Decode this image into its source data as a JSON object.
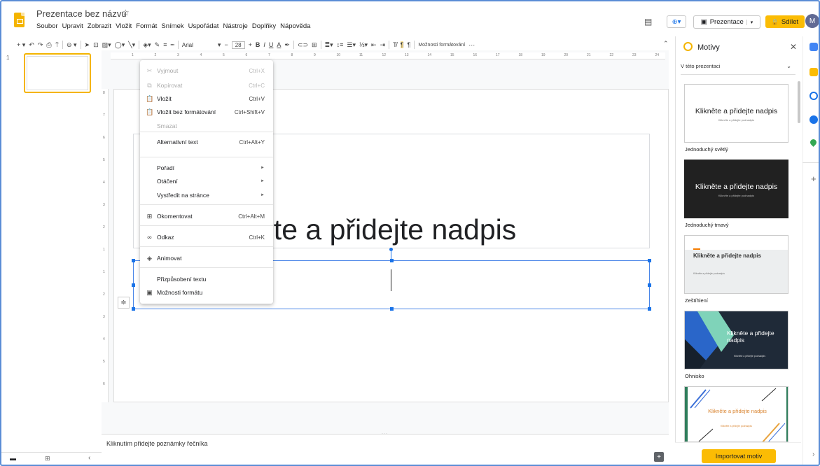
{
  "header": {
    "title": "Prezentace bez názvu",
    "star_icon": "☆",
    "menu": [
      "Soubor",
      "Upravit",
      "Zobrazit",
      "Vložit",
      "Formát",
      "Snímek",
      "Uspořádat",
      "Nástroje",
      "Doplňky",
      "Nápověda"
    ],
    "present_label": "Prezentace",
    "share_label": "Sdílet",
    "avatar_letter": "M"
  },
  "toolbar": {
    "font": "Arial",
    "font_size": "28",
    "format_options": "Možnosti formátování"
  },
  "filmstrip": {
    "slide_number": "1"
  },
  "ruler": {
    "top": [
      "1",
      "2",
      "3",
      "4",
      "5",
      "6",
      "7",
      "8",
      "9",
      "10",
      "11",
      "12",
      "13",
      "14",
      "15",
      "16",
      "17",
      "18",
      "19",
      "20",
      "21",
      "22",
      "23",
      "24"
    ],
    "left": [
      "8",
      "7",
      "6",
      "5",
      "4",
      "3",
      "2",
      "1",
      "1",
      "2",
      "3",
      "4",
      "5",
      "6"
    ]
  },
  "slide": {
    "title_placeholder": "Klikněte a přidejte nadpis",
    "visible_title_part": "ete a přidejte nadpis"
  },
  "notes": {
    "placeholder": "Kliknutím přidejte poznámky řečníka"
  },
  "context_menu": [
    {
      "label": "Vyjmout",
      "shortcut": "Ctrl+X",
      "icon": "✂",
      "disabled": true
    },
    {
      "label": "Kopírovat",
      "shortcut": "Ctrl+C",
      "icon": "⧉",
      "disabled": true
    },
    {
      "label": "Vložit",
      "shortcut": "Ctrl+V",
      "icon": "📋",
      "disabled": false
    },
    {
      "label": "Vložit bez formátování",
      "shortcut": "Ctrl+Shift+V",
      "icon": "📋",
      "disabled": false
    },
    {
      "label": "Smazat",
      "shortcut": "",
      "icon": "",
      "disabled": true
    },
    {
      "label": "Alternativní text",
      "shortcut": "Ctrl+Alt+Y",
      "icon": "",
      "disabled": false
    },
    {
      "label": "Pořadí",
      "shortcut": "",
      "icon": "",
      "arrow": "►",
      "disabled": false
    },
    {
      "label": "Otáčení",
      "shortcut": "",
      "icon": "",
      "arrow": "►",
      "disabled": false
    },
    {
      "label": "Vystředit na stránce",
      "shortcut": "",
      "icon": "",
      "arrow": "►",
      "disabled": false
    },
    {
      "label": "Okomentovat",
      "shortcut": "Ctrl+Alt+M",
      "icon": "⊞",
      "disabled": false
    },
    {
      "label": "Odkaz",
      "shortcut": "Ctrl+K",
      "icon": "∞",
      "disabled": false
    },
    {
      "label": "Animovat",
      "shortcut": "",
      "icon": "◈",
      "disabled": false
    },
    {
      "label": "Přizpůsobení textu",
      "shortcut": "",
      "icon": "",
      "disabled": false
    },
    {
      "label": "Možnosti formátu",
      "shortcut": "",
      "icon": "▣",
      "disabled": false
    }
  ],
  "themes_panel": {
    "title": "Motivy",
    "dropdown": "V této prezentaci",
    "import_label": "Importovat motiv",
    "themes": [
      {
        "name": "Jednoduchý světlý",
        "title": "Klikněte a přidejte nadpis",
        "subtitle": "Klikněte a přidejte podnadpis"
      },
      {
        "name": "Jednoduchý tmavý",
        "title": "Klikněte a přidejte nadpis",
        "subtitle": "Klikněte a přidejte podnadpis"
      },
      {
        "name": "Zeštíhlení",
        "title": "Klikněte a přidejte nadpis",
        "subtitle": "Klikněte a přidejte podnadpis"
      },
      {
        "name": "Ohnisko",
        "title": "Klikněte a přidejte nadpis",
        "subtitle": "Klikněte a přidejte podnadpis"
      },
      {
        "name": "",
        "title": "Klikněte a přidejte nadpis",
        "subtitle": "Klikněte a přidejte podnadpis"
      }
    ]
  },
  "colors": {
    "accent": "#fbbc04",
    "selection": "#1a73e8"
  }
}
